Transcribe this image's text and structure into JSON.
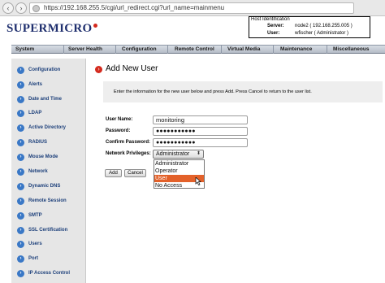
{
  "browser": {
    "url": "https://192.168.255.5/cgi/url_redirect.cgi?url_name=mainmenu"
  },
  "header": {
    "logo_text": "SUPERMICRO",
    "host_identification": {
      "title": "Host Identification",
      "server_label": "Server:",
      "server_value": "node2  ( 192.168.255.005 )",
      "user_label": "User:",
      "user_value": "wfischer   ( Administrator )"
    }
  },
  "top_menu": {
    "items": [
      "System",
      "Server Health",
      "Configuration",
      "Remote Control",
      "Virtual Media",
      "Maintenance",
      "Miscellaneous"
    ]
  },
  "sidebar": {
    "items": [
      {
        "label": "Configuration"
      },
      {
        "label": "Alerts"
      },
      {
        "label": "Date and Time"
      },
      {
        "label": "LDAP"
      },
      {
        "label": "Active Directory"
      },
      {
        "label": "RADIUS"
      },
      {
        "label": "Mouse Mode"
      },
      {
        "label": "Network"
      },
      {
        "label": "Dynamic DNS"
      },
      {
        "label": "Remote Session"
      },
      {
        "label": "SMTP"
      },
      {
        "label": "SSL Certification"
      },
      {
        "label": "Users"
      },
      {
        "label": "Port"
      },
      {
        "label": "IP Access Control"
      }
    ]
  },
  "main": {
    "title": "Add New User",
    "info": "Enter the information for the new user below and press Add. Press Cancel to return to the user list.",
    "form": {
      "username_label": "User Name:",
      "username_value": "monitoring",
      "password_label": "Password:",
      "password_value": "●●●●●●●●●●●",
      "confirm_label": "Confirm Password:",
      "confirm_value": "●●●●●●●●●●●",
      "privileges_label": "Network Privileges:",
      "privileges_selected": "Administrator",
      "privileges_options": [
        "Administrator",
        "Operator",
        "User",
        "No Access"
      ],
      "highlighted_option": "User"
    },
    "buttons": {
      "add": "Add",
      "cancel": "Cancel"
    }
  },
  "colors": {
    "accent": "#d42a1e",
    "link": "#1c3f7a",
    "highlight": "#e3612a"
  }
}
